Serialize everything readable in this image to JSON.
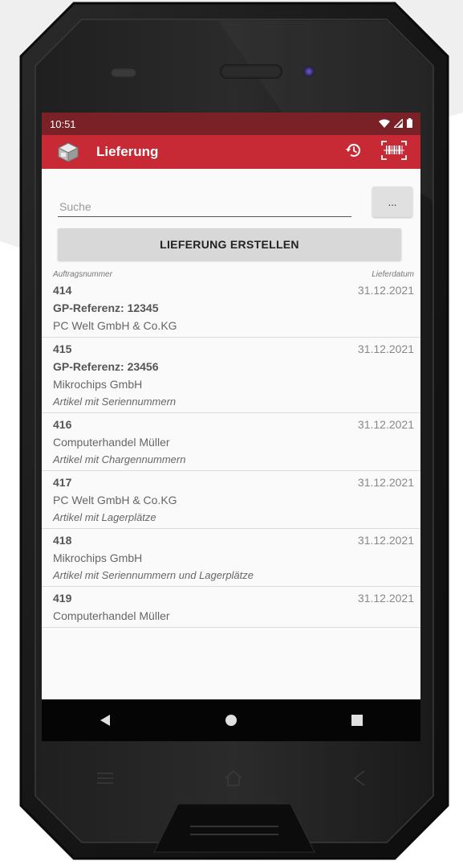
{
  "colors": {
    "appbar": "#c72a34",
    "statusbar": "#7a2127",
    "device_body": "#1c1c1c"
  },
  "statusbar": {
    "time": "10:51",
    "icons": [
      "wifi-icon",
      "signal-icon",
      "battery-icon"
    ]
  },
  "appbar": {
    "title": "Lieferung",
    "logo_icon": "box-logo-icon",
    "actions": [
      "history-icon",
      "barcode-scan-icon"
    ]
  },
  "search": {
    "placeholder": "Suche",
    "value": "",
    "more_label": "..."
  },
  "create_button_label": "LIEFERUNG ERSTELLEN",
  "list_header": {
    "left": "Auftragsnummer",
    "right": "Lieferdatum"
  },
  "items": [
    {
      "order": "414",
      "date": "31.12.2021",
      "gp": "GP-Referenz: 12345",
      "company": "PC Welt GmbH & Co.KG",
      "note": ""
    },
    {
      "order": "415",
      "date": "31.12.2021",
      "gp": "GP-Referenz: 23456",
      "company": "Mikrochips GmbH",
      "note": "Artikel mit Seriennummern"
    },
    {
      "order": "416",
      "date": "31.12.2021",
      "gp": "",
      "company": "Computerhandel Müller",
      "note": "Artikel mit Chargennummern"
    },
    {
      "order": "417",
      "date": "31.12.2021",
      "gp": "",
      "company": "PC Welt GmbH & Co.KG",
      "note": "Artikel mit Lagerplätze"
    },
    {
      "order": "418",
      "date": "31.12.2021",
      "gp": "",
      "company": "Mikrochips GmbH",
      "note": "Artikel mit Seriennummern und Lagerplätze"
    },
    {
      "order": "419",
      "date": "31.12.2021",
      "gp": "",
      "company": "Computerhandel Müller",
      "note": ""
    }
  ],
  "navbar": [
    "back-icon",
    "home-icon",
    "recents-icon"
  ],
  "hardware_keys": [
    "menu-key-icon",
    "home-key-icon",
    "back-key-icon"
  ]
}
